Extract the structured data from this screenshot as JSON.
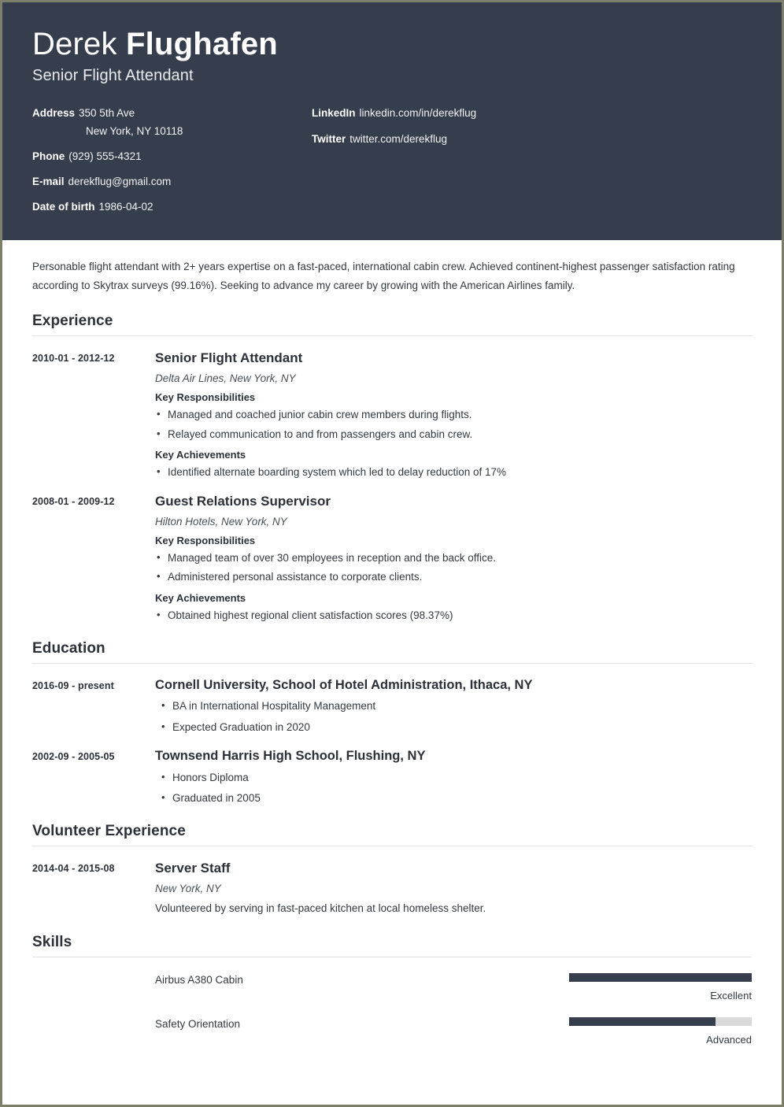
{
  "header": {
    "first_name": "Derek",
    "last_name": "Flughafen",
    "job_title": "Senior Flight Attendant",
    "contacts_left": [
      {
        "label": "Address",
        "value": "350 5th Ave",
        "subline": "New York, NY 10118"
      },
      {
        "label": "Phone",
        "value": "(929) 555-4321"
      },
      {
        "label": "E-mail",
        "value": "derekflug@gmail.com"
      },
      {
        "label": "Date of birth",
        "value": "1986-04-02"
      }
    ],
    "contacts_right": [
      {
        "label": "LinkedIn",
        "value": "linkedin.com/in/derekflug"
      },
      {
        "label": "Twitter",
        "value": "twitter.com/derekflug"
      }
    ]
  },
  "summary": "Personable flight attendant with 2+ years expertise on a fast-paced, international cabin crew. Achieved continent-highest passenger satisfaction rating according to Skytrax surveys (99.16%). Seeking to advance my career by growing with the American Airlines family.",
  "sections": {
    "experience": {
      "title": "Experience",
      "entries": [
        {
          "dates": "2010-01 - 2012-12",
          "title": "Senior Flight Attendant",
          "subtitle": "Delta Air Lines, New York, NY",
          "responsibilities_label": "Key Responsibilities",
          "responsibilities": [
            "Managed and coached junior cabin crew members during flights.",
            "Relayed communication to and from passengers and cabin crew."
          ],
          "achievements_label": "Key Achievements",
          "achievements": [
            "Identified alternate boarding system which led to delay reduction of 17%"
          ]
        },
        {
          "dates": "2008-01 - 2009-12",
          "title": "Guest Relations Supervisor",
          "subtitle": "Hilton Hotels, New York, NY",
          "responsibilities_label": "Key Responsibilities",
          "responsibilities": [
            "Managed team of over 30 employees in reception and the back office.",
            "Administered personal assistance to corporate clients."
          ],
          "achievements_label": "Key Achievements",
          "achievements": [
            "Obtained highest regional client satisfaction scores (98.37%)"
          ]
        }
      ]
    },
    "education": {
      "title": "Education",
      "entries": [
        {
          "dates": "2016-09 - present",
          "title": "Cornell University, School of Hotel Administration, Ithaca, NY",
          "bullets": [
            "BA in International Hospitality Management",
            "Expected Graduation in 2020"
          ]
        },
        {
          "dates": "2002-09 - 2005-05",
          "title": "Townsend Harris High School, Flushing, NY",
          "bullets": [
            "Honors Diploma",
            "Graduated in 2005"
          ]
        }
      ]
    },
    "volunteer": {
      "title": "Volunteer Experience",
      "entries": [
        {
          "dates": "2014-04 - 2015-08",
          "title": "Server Staff",
          "subtitle": "New York, NY",
          "note": "Volunteered by serving in fast-paced kitchen at local homeless shelter."
        }
      ]
    },
    "skills": {
      "title": "Skills",
      "items": [
        {
          "name": "Airbus A380 Cabin",
          "level": "Excellent",
          "percent": 100
        },
        {
          "name": "Safety Orientation",
          "level": "Advanced",
          "percent": 80
        }
      ]
    }
  },
  "colors": {
    "header_bg": "#363d4c",
    "bar_fill": "#363d4c",
    "bar_track": "#d9d9d9",
    "page_border": "#7e7f6a"
  }
}
